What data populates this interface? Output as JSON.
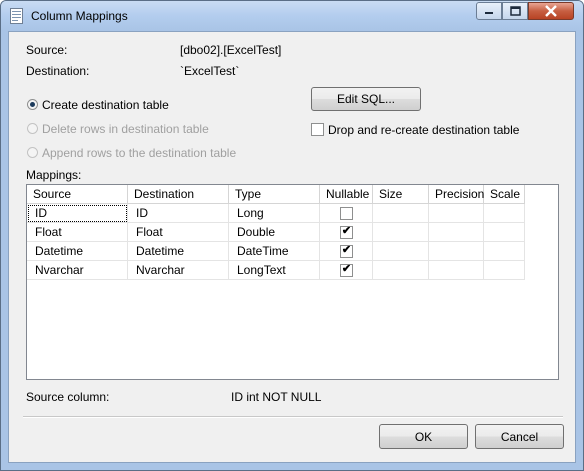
{
  "window": {
    "title": "Column Mappings"
  },
  "info": {
    "source_label": "Source:",
    "source_value": "[dbo02].[ExcelTest]",
    "destination_label": "Destination:",
    "destination_value": "`ExcelTest`"
  },
  "options": {
    "create_table": "Create destination table",
    "delete_rows": "Delete rows in destination table",
    "append_rows": "Append rows to the destination table",
    "edit_sql": "Edit SQL...",
    "drop_recreate": "Drop and re-create destination table",
    "selected_option": "create_table",
    "drop_recreate_checked": false
  },
  "mappings": {
    "label": "Mappings:",
    "columns": [
      "Source",
      "Destination",
      "Type",
      "Nullable",
      "Size",
      "Precision",
      "Scale"
    ],
    "rows": [
      {
        "source": "ID",
        "destination": "ID",
        "type": "Long",
        "nullable": false,
        "size": "",
        "precision": "",
        "scale": ""
      },
      {
        "source": "Float",
        "destination": "Float",
        "type": "Double",
        "nullable": true,
        "size": "",
        "precision": "",
        "scale": ""
      },
      {
        "source": "Datetime",
        "destination": "Datetime",
        "type": "DateTime",
        "nullable": true,
        "size": "",
        "precision": "",
        "scale": ""
      },
      {
        "source": "Nvarchar",
        "destination": "Nvarchar",
        "type": "LongText",
        "nullable": true,
        "size": "",
        "precision": "",
        "scale": ""
      }
    ]
  },
  "footer": {
    "source_column_label": "Source column:",
    "source_column_value": "ID int NOT NULL",
    "ok": "OK",
    "cancel": "Cancel"
  },
  "icons": {
    "app": "document-table-icon",
    "minimize": "minimize-icon",
    "maximize": "maximize-icon",
    "close": "close-icon"
  }
}
